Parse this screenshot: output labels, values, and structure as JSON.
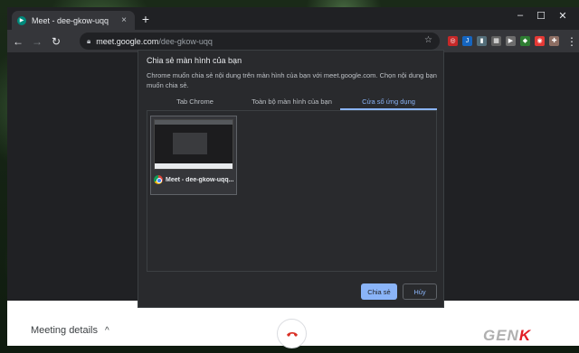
{
  "window": {
    "tab_title": "Meet - dee-gkow-uqq",
    "tab_close": "×",
    "newtab": "+",
    "minimize": "–",
    "maximize": "☐",
    "close": "✕"
  },
  "toolbar": {
    "back": "←",
    "forward": "→",
    "reload": "↻",
    "url_host": "meet.google.com",
    "url_path": "/dee-gkow-uqq",
    "star": "☆",
    "menu": "⋮"
  },
  "extensions": [
    {
      "name": "ext-red",
      "glyph": "◎",
      "color": "#c62828"
    },
    {
      "name": "ext-j",
      "glyph": "J",
      "color": "#1565c0"
    },
    {
      "name": "ext-bars",
      "glyph": "▮",
      "color": "#546e7a"
    },
    {
      "name": "ext-grid",
      "glyph": "▦",
      "color": "#616161"
    },
    {
      "name": "ext-play",
      "glyph": "▶",
      "color": "#6d6d6d"
    },
    {
      "name": "ext-green",
      "glyph": "◆",
      "color": "#2e7d32"
    },
    {
      "name": "ext-pocket",
      "glyph": "◉",
      "color": "#e53935"
    },
    {
      "name": "ext-puzzle",
      "glyph": "✚",
      "color": "#8d6e63"
    }
  ],
  "dialog": {
    "title": "Chia sẻ màn hình của bạn",
    "description": "Chrome muốn chia sẻ nội dung trên màn hình của bạn với meet.google.com. Chọn nội dung bạn muốn chia sẻ.",
    "tabs": [
      {
        "label": "Tab Chrome",
        "active": false
      },
      {
        "label": "Toàn bộ màn hình của bạn",
        "active": false
      },
      {
        "label": "Cửa sổ ứng dụng",
        "active": true
      }
    ],
    "window_item": "Meet - dee-gkow-uqq...",
    "share_button": "Chia sẻ",
    "cancel_button": "Hủy"
  },
  "meet": {
    "meeting_details": "Meeting details",
    "chevron": "^"
  },
  "watermark": {
    "part1": "GEN",
    "part2": "K"
  },
  "colors": {
    "accent": "#8ab4f8",
    "hangup": "#d93025",
    "dialog_bg": "#292a2d",
    "watermark_red": "#e21e26"
  }
}
